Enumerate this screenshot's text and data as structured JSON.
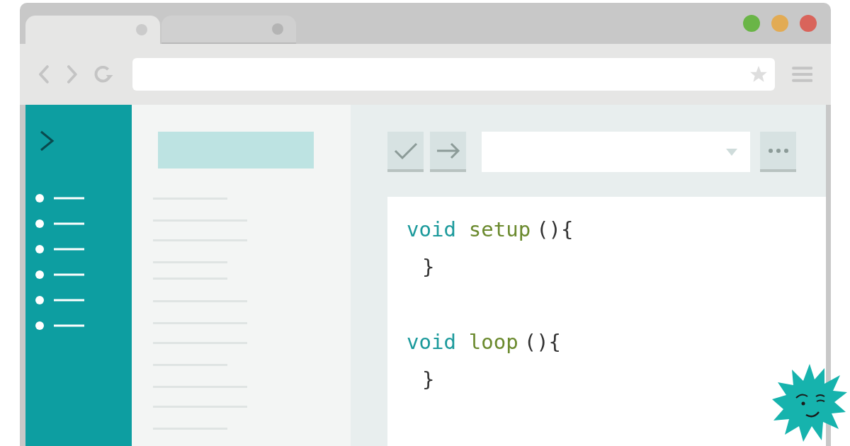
{
  "tabs": [
    {
      "selected": true
    },
    {
      "selected": false
    }
  ],
  "window_controls": [
    {
      "color": "#6ab547"
    },
    {
      "color": "#e2ab54"
    },
    {
      "color": "#d9645b"
    }
  ],
  "code": [
    {
      "signature": [
        {
          "kind": "keyword",
          "text": "void"
        },
        {
          "kind": "name",
          "text": "setup"
        },
        {
          "kind": "punct",
          "text": "(){"
        }
      ],
      "closing": "}"
    },
    {
      "signature": [
        {
          "kind": "keyword",
          "text": "void"
        },
        {
          "kind": "name",
          "text": "loop"
        },
        {
          "kind": "punct",
          "text": "(){"
        }
      ],
      "closing": "}"
    }
  ]
}
